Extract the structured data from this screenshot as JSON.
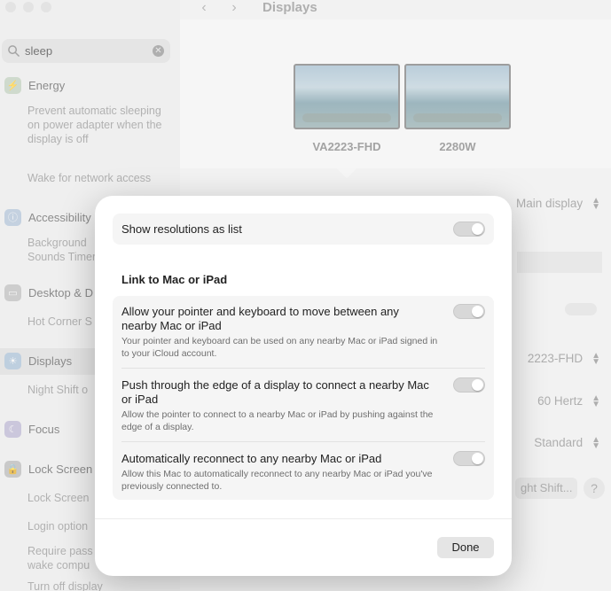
{
  "window": {
    "title": "Displays"
  },
  "search": {
    "value": "sleep"
  },
  "sidebar": {
    "energy": {
      "label": "Energy",
      "results": [
        "Prevent automatic sleeping on power adapter when the display is off",
        "Wake for network access"
      ]
    },
    "accessibility": {
      "label": "Accessibility",
      "results": [
        "Background Sounds Timer"
      ]
    },
    "desktop_dock": {
      "label": "Desktop & D",
      "results": [
        "Hot Corner S"
      ]
    },
    "displays": {
      "label": "Displays",
      "results": [
        "Night Shift o"
      ]
    },
    "focus": {
      "label": "Focus"
    },
    "lock_screen": {
      "label": "Lock Screen",
      "results": [
        "Lock Screen",
        "Login option",
        "Require pass wake compu",
        "Turn off display"
      ]
    }
  },
  "displays": [
    {
      "name": "VA2223-FHD",
      "selected": true
    },
    {
      "name": "2280W",
      "selected": false
    }
  ],
  "settings_bg": {
    "use_as": "Main display",
    "display_value": "2223-FHD",
    "refresh_rate": "60 Hertz",
    "rotation": "Standard",
    "night_shift_button": "ght Shift...",
    "help": "?"
  },
  "sheet": {
    "show_resolutions_as_list": "Show resolutions as list",
    "section_title": "Link to Mac or iPad",
    "rows": [
      {
        "title": "Allow your pointer and keyboard to move between any nearby Mac or iPad",
        "subtitle": "Your pointer and keyboard can be used on any nearby Mac or iPad signed in to your iCloud account."
      },
      {
        "title": "Push through the edge of a display to connect a nearby Mac or iPad",
        "subtitle": "Allow the pointer to connect to a nearby Mac or iPad by pushing against the edge of a display."
      },
      {
        "title": "Automatically reconnect to any nearby Mac or iPad",
        "subtitle": "Allow this Mac to automatically reconnect to any nearby Mac or iPad you've previously connected to."
      }
    ],
    "done_label": "Done"
  }
}
